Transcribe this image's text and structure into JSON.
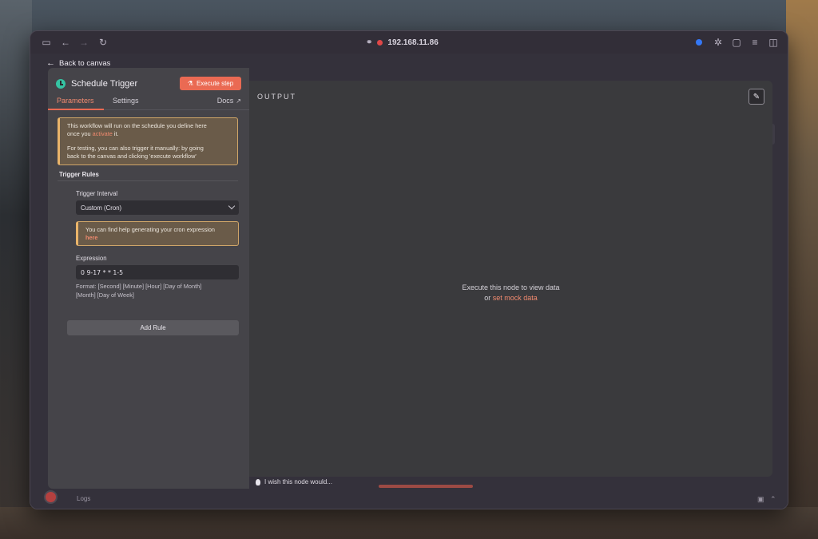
{
  "browser": {
    "url": "192.168.11.86"
  },
  "nav": {
    "back_label": "Back to canvas"
  },
  "node": {
    "title": "Schedule Trigger",
    "execute_label": "Execute step"
  },
  "tabs": {
    "parameters": "Parameters",
    "settings": "Settings",
    "docs": "Docs"
  },
  "notice": {
    "line1": "This workflow will run on the schedule you define here",
    "line2_prefix": "once you ",
    "line2_link": "activate",
    "line2_suffix": " it.",
    "line3": "For testing, you can also trigger it manually: by going",
    "line4": "back to the canvas and clicking 'execute workflow'"
  },
  "trigger_rules": {
    "section_title": "Trigger Rules",
    "interval_label": "Trigger Interval",
    "interval_value": "Custom (Cron)",
    "cron_help_text": "You can find help generating your cron expression",
    "cron_help_link": "here",
    "expression_label": "Expression",
    "expression_value": "0 9-17 * * 1-5",
    "format_line1": "Format: [Second] [Minute] [Hour] [Day of Month]",
    "format_line2": "[Month] [Day of Week]",
    "add_rule_label": "Add Rule"
  },
  "output": {
    "title": "OUTPUT",
    "empty_line1": "Execute this node to view data",
    "empty_line2_prefix": "or ",
    "empty_line2_link": "set mock data"
  },
  "footer": {
    "wish_label": "I wish this node would...",
    "logs_label": "Logs"
  },
  "colors": {
    "accent": "#ea6a53",
    "trigger_icon": "#35c4a3",
    "warning_border": "#e9b46a"
  }
}
